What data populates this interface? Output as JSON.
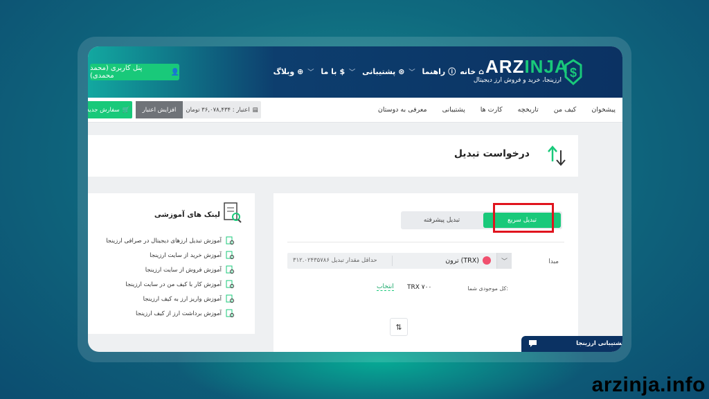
{
  "header": {
    "logo_main": "ARZ",
    "logo_accent": "INJA",
    "logo_sub": "ارزینجا، خرید و فروش ارز دیجیتال",
    "nav": [
      {
        "label": "خانه",
        "icon": "home-icon",
        "chevron": false
      },
      {
        "label": "راهنما",
        "icon": "help-icon",
        "chevron": true
      },
      {
        "label": "پشتیبانی",
        "icon": "support-icon",
        "chevron": true
      },
      {
        "label": "با ما",
        "icon": "money-icon",
        "chevron": true
      },
      {
        "label": "وبلاگ",
        "icon": "globe-icon",
        "chevron": false
      }
    ],
    "panel_label": "پنل کاربری (محمد محمدی)"
  },
  "subnav": {
    "items": [
      "پیشخوان",
      "کیف من",
      "تاریخچه",
      "کارت ها",
      "پشتیبانی",
      "معرفی به دوستان"
    ],
    "credit_label": "اعتبار : ۳۶,۰۷۸,۴۳۴ تومان",
    "increase_label": "افزایش اعتبار",
    "order_label": "سفارش جدید"
  },
  "page": {
    "title": "درخواست تبدیل"
  },
  "learn": {
    "title": "لینک های آموزشی",
    "items": [
      "آموزش تبدیل ارزهای دیجیتال در صرافی ارزینجا",
      "آموزش خرید از سایت ارزینجا",
      "آموزش فروش از سایت ارزینجا",
      "آموزش کار با کیف من در سایت ارزینجا",
      "آموزش واریز ارز به کیف ارزینجا",
      "آموزش برداشت ارز از کیف ارزینجا"
    ]
  },
  "convert": {
    "tab_quick": "تبدیل سریع",
    "tab_advanced": "تبدیل پیشرفته",
    "source_label": "مبدا",
    "source_coin": "ترون (TRX)",
    "min_text": "حداقل مقدار تبدیل ۳۱۲.۰۲۴۳۵۷۸۶",
    "balance_label": "کل موجودی شما:",
    "balance_value": "TRX ۷۰۰",
    "select_label": "انتخاب",
    "swap_glyph": "⇅"
  },
  "support": {
    "label": "پشتیبانی ارزینجا"
  },
  "watermark": "arzinja.info",
  "colors": {
    "brand_green": "#19c97a",
    "header_navy": "#0b3263",
    "highlight_red": "#e0141e"
  }
}
